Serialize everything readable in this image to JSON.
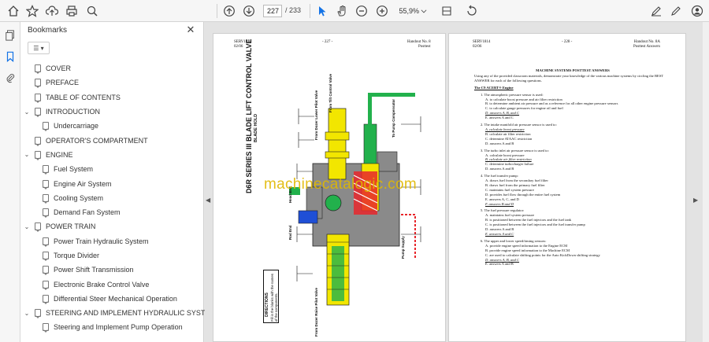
{
  "toolbar": {
    "page_current": "227",
    "page_total": "/ 233",
    "zoom": "55,9%",
    "icons": [
      "home-icon",
      "bookmark-star-icon",
      "upload-icon",
      "print-icon",
      "search-icon",
      "up-icon",
      "down-icon",
      "cursor-icon",
      "hand-icon",
      "zoom-out-icon",
      "zoom-in-icon",
      "fit-icon",
      "comment-icon",
      "edit-icon",
      "share-icon",
      "account-icon"
    ]
  },
  "panel": {
    "title": "Bookmarks",
    "close": "✕",
    "options": "☰ ▾",
    "bookmarks": [
      {
        "label": "COVER",
        "level": 0,
        "chevron": ""
      },
      {
        "label": "PREFACE",
        "level": 0,
        "chevron": ""
      },
      {
        "label": "TABLE OF CONTENTS",
        "level": 0,
        "chevron": ""
      },
      {
        "label": "INTRODUCTION",
        "level": 0,
        "chevron": "⌄"
      },
      {
        "label": "Undercarriage",
        "level": 1,
        "chevron": ""
      },
      {
        "label": "OPERATOR'S COMPARTMENT",
        "level": 0,
        "chevron": ""
      },
      {
        "label": "ENGINE",
        "level": 0,
        "chevron": "⌄"
      },
      {
        "label": "Fuel System",
        "level": 1,
        "chevron": ""
      },
      {
        "label": "Engine Air System",
        "level": 1,
        "chevron": ""
      },
      {
        "label": "Cooling System",
        "level": 1,
        "chevron": ""
      },
      {
        "label": "Demand Fan System",
        "level": 1,
        "chevron": ""
      },
      {
        "label": "POWER TRAIN",
        "level": 0,
        "chevron": "⌄"
      },
      {
        "label": "Power Train Hydraulic System",
        "level": 1,
        "chevron": ""
      },
      {
        "label": "Torque Divider",
        "level": 1,
        "chevron": ""
      },
      {
        "label": "Power Shift Transmission",
        "level": 1,
        "chevron": ""
      },
      {
        "label": "Electronic Brake Control Valve",
        "level": 1,
        "chevron": ""
      },
      {
        "label": "Differential Steer Mechanical Operation",
        "level": 1,
        "chevron": ""
      },
      {
        "label": "STEERING AND IMPLEMENT HYDRAULIC SYSTEM",
        "level": 0,
        "chevron": "⌄"
      },
      {
        "label": "Steering and Implement Pump Operation",
        "level": 1,
        "chevron": ""
      }
    ]
  },
  "page_left": {
    "hdr_left": "SERV1814\n02/06",
    "hdr_center": "- 227 -",
    "hdr_right": "Handout No. 8\nPosttest",
    "title": "D6R SERIES III BLADE LIFT CONTROL VALVE",
    "subtitle": "BLADE HOLD",
    "labels": {
      "from_tilt": "From Tilt Control Valve",
      "from_lower": "From Dozer Lower Pilot Valve",
      "to_pump": "To Pump Compensator",
      "head_end": "Head End",
      "rod_end": "Rod End",
      "pump_supply": "Pump Supply",
      "from_raise": "From Dozer Raise Pilot Valve"
    },
    "directions_title": "DIRECTIONS",
    "directions_text": "Fill in the blanks with the names of the components."
  },
  "watermark": "machinecatalogic.com",
  "page_right": {
    "hdr_left": "SERV1814\n02/06",
    "hdr_center": "- 228 -",
    "hdr_right": "Handout No. 8A\nPosttest Answers",
    "title": "MACHINE SYSTEMS POSTTEST ANSWERS",
    "intro": "Using any of the provided classroom materials, demonstrate your knowledge of the various machine systems by circling the BEST ANSWER for each of the following questions.",
    "section": "The C9 ACERT® Engine",
    "questions": [
      {
        "q": "1.  The atmospheric pressure sensor is used:",
        "opts": [
          "A.  to calculate boost pressure and air filter restriction",
          "B.  to determine ambient air pressure and as a reference for all other engine pressure sensors",
          "C.  to calculate gauge pressures for engine oil and fuel",
          "D.  answers A, B, and C",
          "E.  answers A and C"
        ],
        "ans": 3
      },
      {
        "q": "2.  The intake manifold air pressure sensor is used to:",
        "opts": [
          "A.  calculate boost pressure",
          "B.  calculate air filter restriction",
          "C.  determine ATAAC restriction",
          "D.  answers A and B"
        ],
        "ans": 0
      },
      {
        "q": "3.  The turbo inlet air pressure sensor is used to:",
        "opts": [
          "A.  calculate boost pressure",
          "B.  calculate air filter restriction",
          "C.  determine turbocharger failure",
          "D.  answers A and B"
        ],
        "ans": 1
      },
      {
        "q": "4.  The fuel transfer pump:",
        "opts": [
          "A.  draws fuel from the secondary fuel filter",
          "B.  draws fuel from the primary fuel filter",
          "C.  maintains fuel system pressure",
          "D.  provides fuel flow through the entire fuel system",
          "E.  answers A, C, and D",
          "F.  answers B and D"
        ],
        "ans": 5
      },
      {
        "q": "5.  The fuel pressure regulator:",
        "opts": [
          "A.  maintains fuel system pressure",
          "B.  is positioned between the fuel injectors and the fuel tank",
          "C.  is positioned between the fuel injectors and the fuel transfer pump",
          "D.  answers A and B",
          "E.  answers A and C"
        ],
        "ans": 4
      },
      {
        "q": "6.  The upper and lower speed/timing sensors:",
        "opts": [
          "A.  provide engine speed information to the Engine ECM",
          "B.  provide engine speed information to the Machine ECM",
          "C.  are used to calculate shifting points for the Auto KickDown shifting strategy",
          "D.  answers A, B, and C",
          "E.  answers A and B"
        ],
        "ans": 3
      }
    ]
  },
  "colors": {
    "accent": "#1473e6",
    "yellow": "#f2e600",
    "green": "#22b14c",
    "red": "#e8262b",
    "blue": "#1f4fd6",
    "gray": "#8a8a8a"
  }
}
